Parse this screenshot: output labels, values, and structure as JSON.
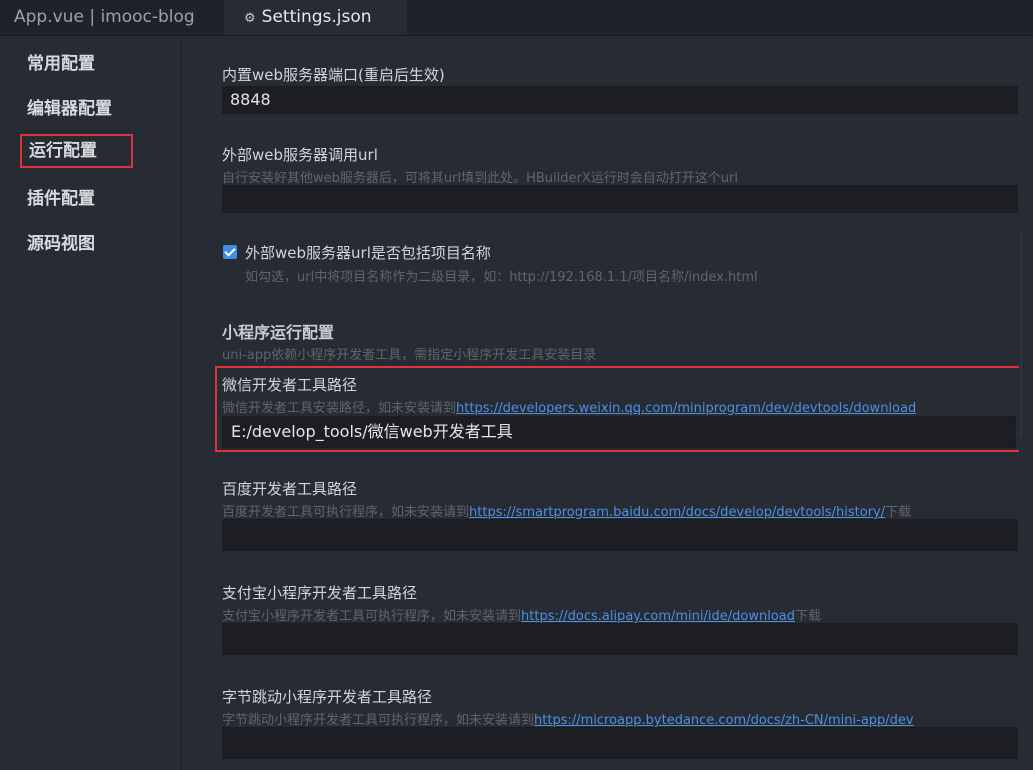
{
  "tabs": {
    "inactive": "App.vue | imooc-blog",
    "active": "Settings.json"
  },
  "sidebar": {
    "items": [
      "常用配置",
      "编辑器配置",
      "运行配置",
      "插件配置",
      "源码视图"
    ]
  },
  "settings": {
    "port": {
      "label": "内置web服务器端口(重启后生效)",
      "value": "8848"
    },
    "external_url": {
      "label": "外部web服务器调用url",
      "desc": "自行安装好其他web服务器后，可将其url填到此处。HBuilderX运行时会自动打开这个url",
      "value": ""
    },
    "include_project": {
      "label": "外部web服务器url是否包括项目名称",
      "desc": "如勾选，url中将项目名称作为二级目录，如：http://192.168.1.1/项目名称/index.html",
      "checked": true
    },
    "miniprogram_section": {
      "title": "小程序运行配置",
      "desc": "uni-app依赖小程序开发者工具，需指定小程序开发工具安装目录"
    },
    "weixin": {
      "label": "微信开发者工具路径",
      "desc_prefix": "微信开发者工具安装路径，如未安装请到",
      "link": "https://developers.weixin.qq.com/miniprogram/dev/devtools/download",
      "value": "E:/develop_tools/微信web开发者工具"
    },
    "baidu": {
      "label": "百度开发者工具路径",
      "desc_prefix": "百度开发者工具可执行程序，如未安装请到",
      "link": "https://smartprogram.baidu.com/docs/develop/devtools/history/",
      "desc_suffix": "下载",
      "value": ""
    },
    "alipay": {
      "label": "支付宝小程序开发者工具路径",
      "desc_prefix": "支付宝小程序开发者工具可执行程序，如未安装请到",
      "link": "https://docs.alipay.com/mini/ide/download",
      "desc_suffix": "下载",
      "value": ""
    },
    "bytedance": {
      "label": "字节跳动小程序开发者工具路径",
      "desc_prefix": "字节跳动小程序开发者工具可执行程序，如未安装请到",
      "link": "https://microapp.bytedance.com/docs/zh-CN/mini-app/dev",
      "value": ""
    }
  },
  "colors": {
    "highlight": "#e0323a",
    "link": "#4f8fe0",
    "checkbox": "#3d8fe6"
  }
}
